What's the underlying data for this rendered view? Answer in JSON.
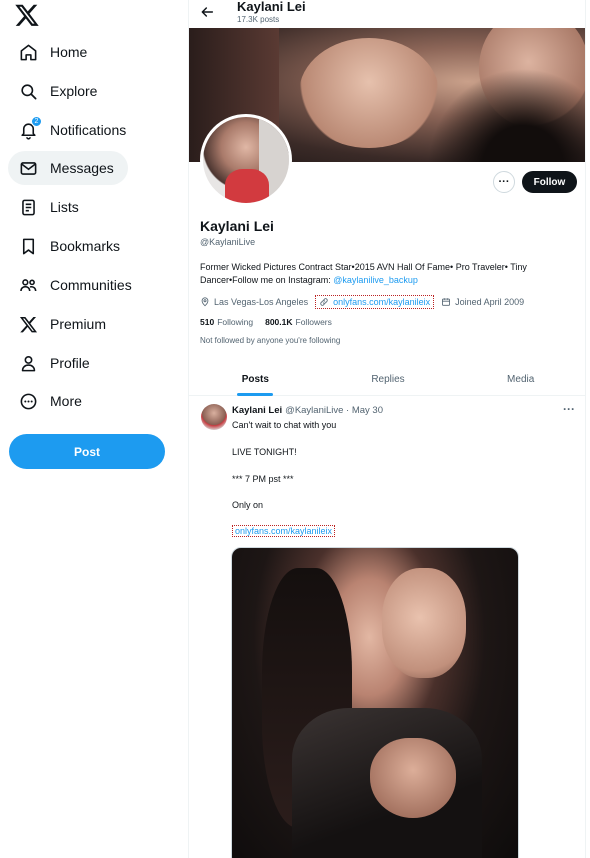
{
  "nav": {
    "items": [
      {
        "label": "Home",
        "icon": "home-icon"
      },
      {
        "label": "Explore",
        "icon": "search-icon"
      },
      {
        "label": "Notifications",
        "icon": "bell-icon",
        "badge": "2"
      },
      {
        "label": "Messages",
        "icon": "envelope-icon"
      },
      {
        "label": "Lists",
        "icon": "list-icon"
      },
      {
        "label": "Bookmarks",
        "icon": "bookmark-icon"
      },
      {
        "label": "Communities",
        "icon": "people-icon"
      },
      {
        "label": "Premium",
        "icon": "x-logo-icon"
      },
      {
        "label": "Profile",
        "icon": "person-icon"
      },
      {
        "label": "More",
        "icon": "more-circle-icon"
      }
    ],
    "post_label": "Post"
  },
  "header": {
    "name": "Kaylani Lei",
    "post_count": "17.3K posts"
  },
  "profile": {
    "name": "Kaylani Lei",
    "handle": "@KaylaniLive",
    "bio_text": "Former Wicked Pictures Contract Star•2015 AVN Hall Of Fame• Pro Traveler• Tiny Dancer•Follow me on Instagram: ",
    "bio_link": "@kaylanilive_backup",
    "location": "Las Vegas-Los Angeles",
    "website": "onlyfans.com/kaylanileix",
    "joined": "Joined April 2009",
    "following_count": "510",
    "following_label": "Following",
    "followers_count": "800.1K",
    "followers_label": "Followers",
    "not_followed": "Not followed by anyone you're following",
    "more_label": "···",
    "follow_label": "Follow"
  },
  "tabs": [
    "Posts",
    "Replies",
    "Media"
  ],
  "tweet": {
    "name": "Kaylani Lei",
    "handle_date": "@KaylaniLive · May 30",
    "lines": [
      "Can't wait to chat with you",
      "LIVE TONIGHT!",
      "*** 7 PM pst ***",
      "Only on"
    ],
    "link": "onlyfans.com/kaylanileix",
    "more": "···"
  },
  "colors": {
    "accent": "#1d9bf0",
    "text": "#0f1419",
    "muted": "#536471"
  }
}
